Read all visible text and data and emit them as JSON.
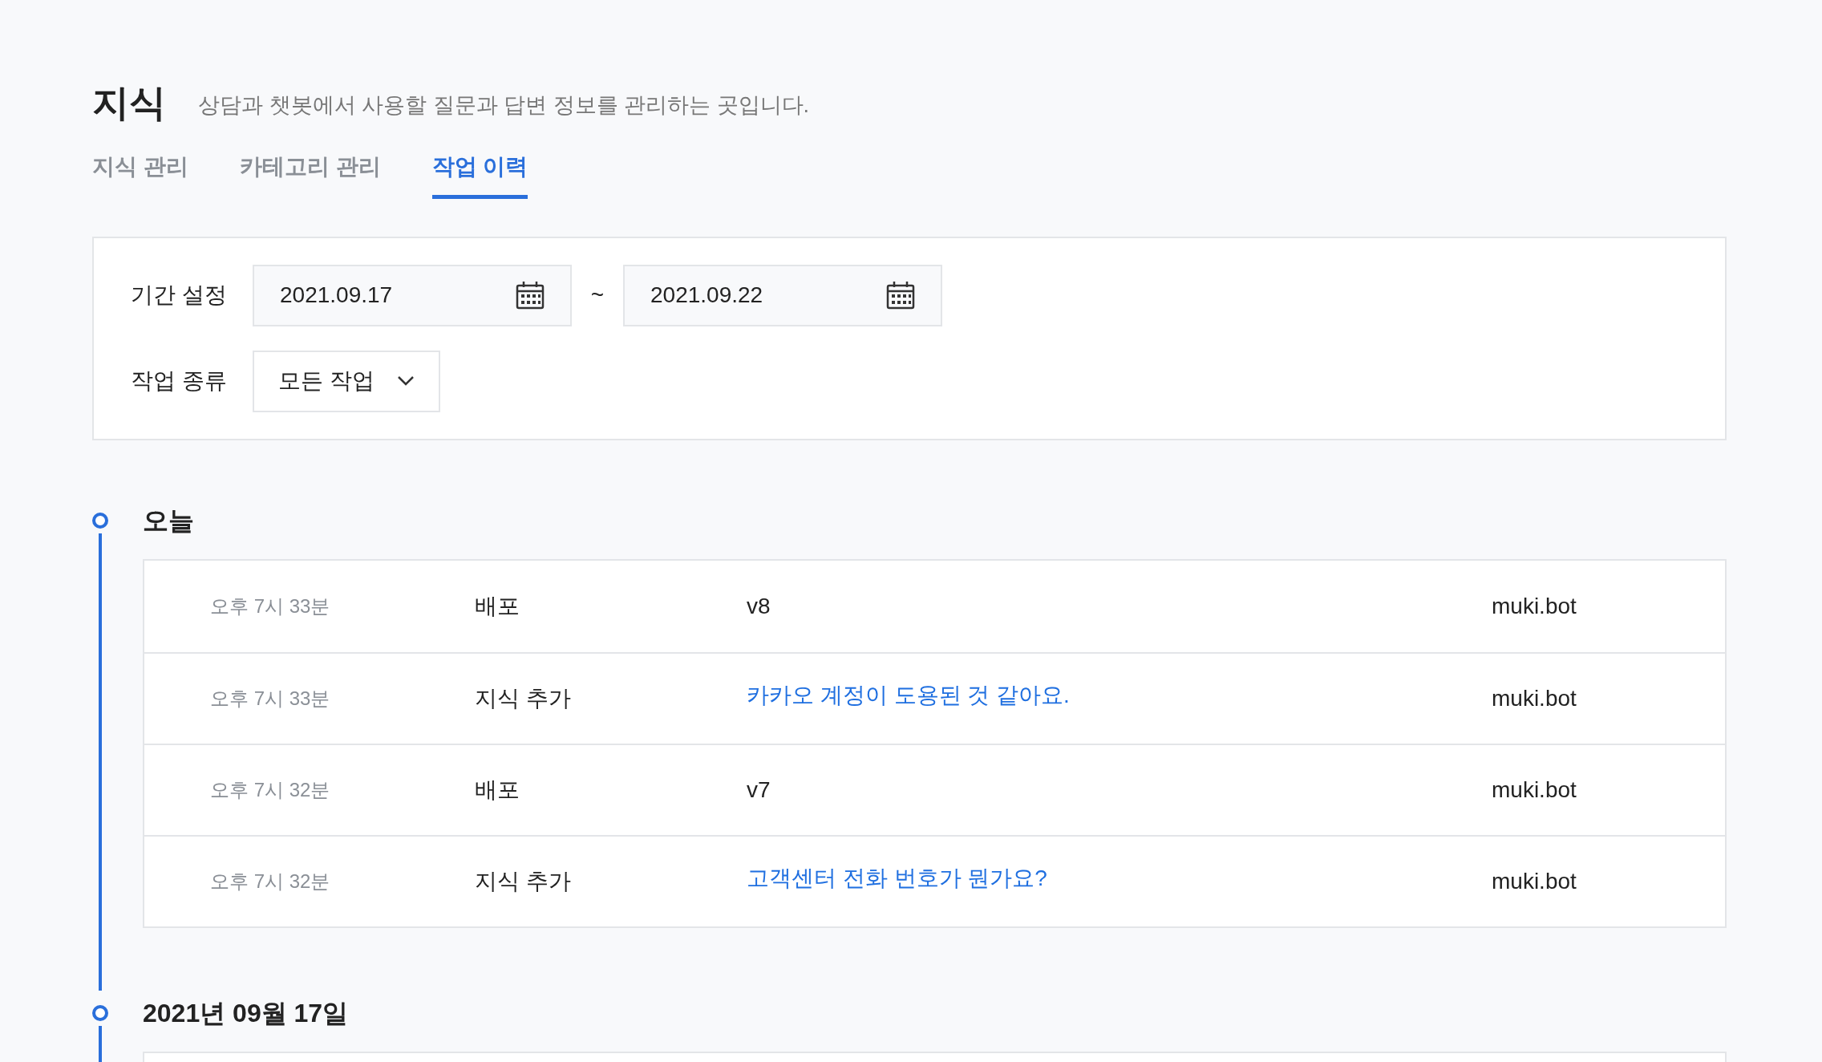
{
  "page": {
    "title": "지식",
    "description": "상담과 챗봇에서 사용할 질문과 답변 정보를 관리하는 곳입니다."
  },
  "tabs": [
    {
      "label": "지식 관리",
      "selected": false
    },
    {
      "label": "카테고리 관리",
      "selected": false
    },
    {
      "label": "작업 이력",
      "selected": true
    }
  ],
  "filters": {
    "period_label": "기간 설정",
    "start_date": "2021.09.17",
    "separator": "~",
    "end_date": "2021.09.22",
    "type_label": "작업 종류",
    "type_value": "모든 작업"
  },
  "timeline": [
    {
      "heading": "오늘",
      "rows": [
        {
          "kind": "text",
          "time": "오후 7시 33분",
          "action": "배포",
          "content": "v8",
          "author": "muki.bot"
        },
        {
          "kind": "link",
          "time": "오후 7시 33분",
          "action": "지식 추가",
          "content": "카카오 계정이 도용된 것 같아요.",
          "author": "muki.bot"
        },
        {
          "kind": "text",
          "time": "오후 7시 32분",
          "action": "배포",
          "content": "v7",
          "author": "muki.bot"
        },
        {
          "kind": "link",
          "time": "오후 7시 32분",
          "action": "지식 추가",
          "content": "고객센터 전화 번호가 뭔가요?",
          "author": "muki.bot"
        }
      ]
    },
    {
      "heading": "2021년 09월 17일"
    }
  ]
}
